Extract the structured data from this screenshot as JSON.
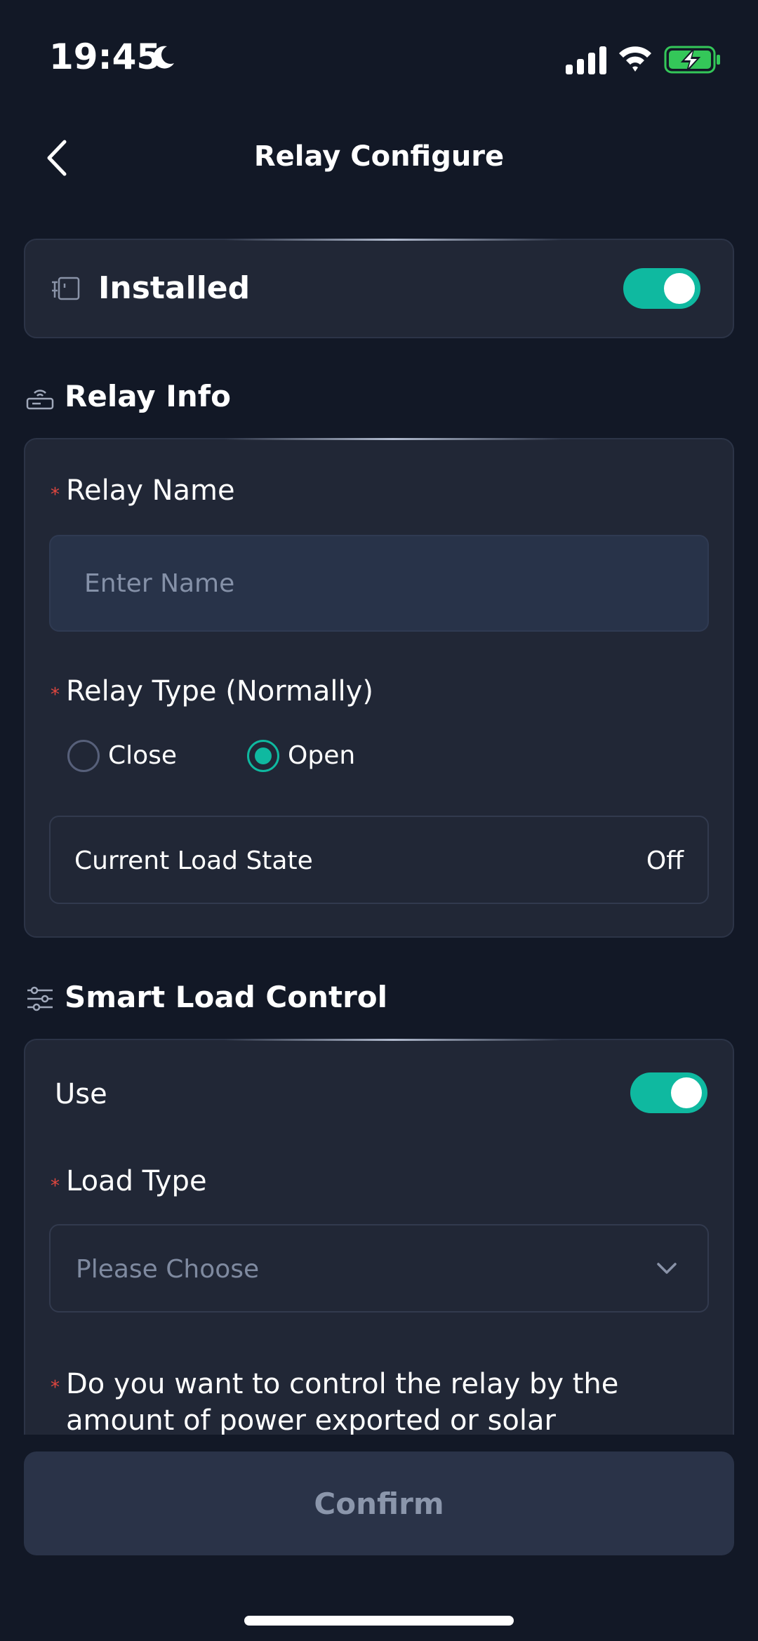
{
  "status_bar": {
    "time": "19:45",
    "icons": [
      "moon-icon",
      "signal-icon",
      "wifi-icon",
      "battery-charging-icon"
    ]
  },
  "header": {
    "title": "Relay Configure",
    "back_icon": "chevron-left-icon"
  },
  "installed": {
    "label": "Installed",
    "icon": "relay-device-icon",
    "enabled": true
  },
  "relay_info": {
    "section_title": "Relay Info",
    "section_icon": "router-icon",
    "required_mark": "*",
    "name_label": "Relay Name",
    "name_placeholder": "Enter Name",
    "name_value": "",
    "type_label": "Relay Type (Normally)",
    "type_options": [
      "Close",
      "Open"
    ],
    "type_selected": "Open",
    "load_state_label": "Current Load State",
    "load_state_value": "Off"
  },
  "smart_load_control": {
    "section_title": "Smart Load Control",
    "section_icon": "sliders-icon",
    "use_label": "Use",
    "use_enabled": true,
    "load_type_label": "Load Type",
    "load_type_placeholder": "Please Choose",
    "question": "Do you want to control the relay by the amount of power exported or solar generation?"
  },
  "footer": {
    "confirm_label": "Confirm"
  },
  "colors": {
    "background": "#121826",
    "card": "#212736",
    "accent": "#0fb9a0",
    "required": "#e0473f",
    "battery": "#34c759"
  }
}
